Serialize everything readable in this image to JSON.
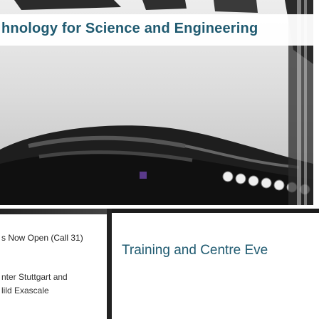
{
  "hero": {
    "title": "hnology for Science and Engineering"
  },
  "cards": [
    {
      "status": "s Now Open (Call 31)",
      "description_line1": "nter Stuttgart and",
      "description_line2": "lild Exascale"
    },
    {
      "title": "Training and Centre Eve"
    }
  ],
  "colors": {
    "title_teal": "#1f5a70",
    "photo_gray": "#d6d6d6"
  }
}
